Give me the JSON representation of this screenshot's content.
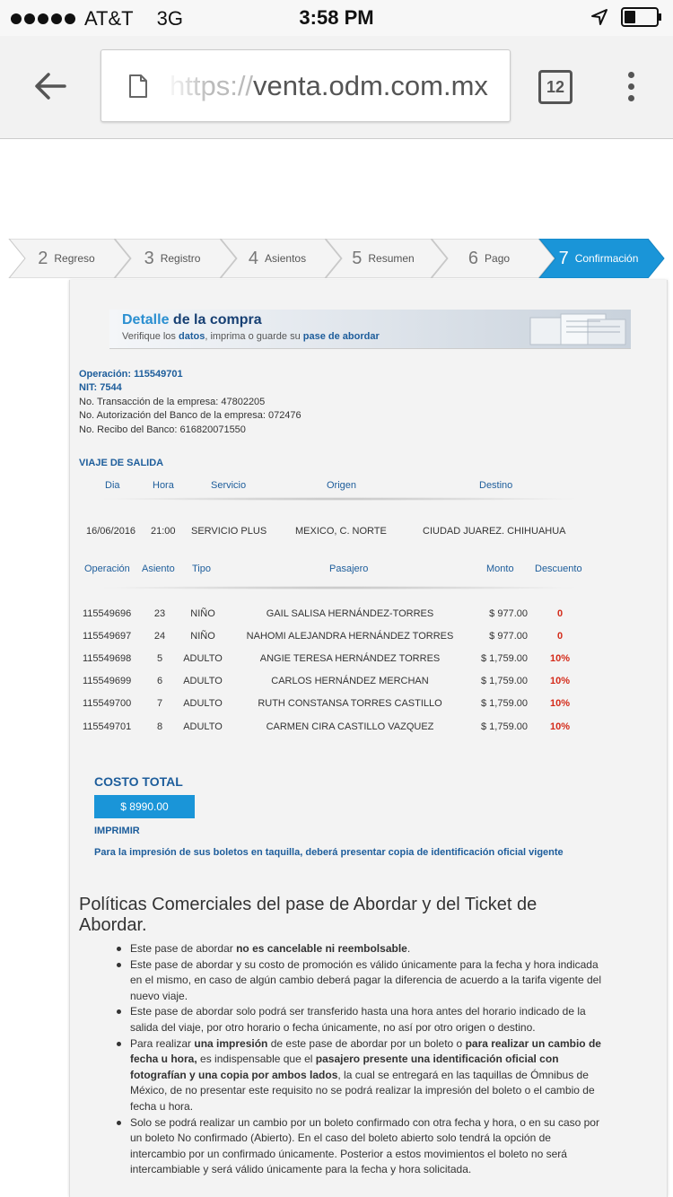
{
  "status_bar": {
    "carrier": "AT&T",
    "network": "3G",
    "time": "3:58 PM",
    "battery_level": 0.35
  },
  "browser": {
    "url_prefix": "https://",
    "url_domain": "venta.odm.com.mx",
    "tab_count": "12"
  },
  "steps": [
    {
      "num": "2",
      "label": "Regreso",
      "active": false
    },
    {
      "num": "3",
      "label": "Registro",
      "active": false
    },
    {
      "num": "4",
      "label": "Asientos",
      "active": false
    },
    {
      "num": "5",
      "label": "Resumen",
      "active": false
    },
    {
      "num": "6",
      "label": "Pago",
      "active": false
    },
    {
      "num": "7",
      "label": "Confirmación",
      "active": true
    }
  ],
  "banner": {
    "title_a": "Detalle ",
    "title_b": "de ",
    "title_c": "la compra",
    "sub_1": "Verifique los ",
    "sub_2": "datos",
    "sub_3": ", imprima o guarde su ",
    "sub_4": "pase de abordar"
  },
  "operation": {
    "operacion": "Operación: 115549701",
    "nit": "NIT: 7544",
    "transaccion": "No. Transacción de la empresa: 47802205",
    "autorizacion": "No. Autorización del Banco de la empresa: 072476",
    "recibo": "No. Recibo del Banco: 616820071550"
  },
  "trip": {
    "section_title": "VIAJE DE SALIDA",
    "headers": {
      "dia": "Dia",
      "hora": "Hora",
      "servicio": "Servicio",
      "origen": "Origen",
      "destino": "Destino"
    },
    "row": {
      "dia": "16/06/2016",
      "hora": "21:00",
      "servicio": "SERVICIO PLUS",
      "origen": "MEXICO, C. NORTE",
      "destino": "CIUDAD JUAREZ. CHIHUAHUA"
    }
  },
  "passengers": {
    "headers": {
      "operacion": "Operación",
      "asiento": "Asiento",
      "tipo": "Tipo",
      "pasajero": "Pasajero",
      "monto": "Monto",
      "descuento": "Descuento"
    },
    "rows": [
      {
        "operacion": "115549696",
        "asiento": "23",
        "tipo": "NIÑO",
        "pasajero": "GAIL SALISA HERNÁNDEZ-TORRES",
        "monto": "$ 977.00",
        "descuento": "0"
      },
      {
        "operacion": "115549697",
        "asiento": "24",
        "tipo": "NIÑO",
        "pasajero": "NAHOMI ALEJANDRA HERNÁNDEZ TORRES",
        "monto": "$ 977.00",
        "descuento": "0"
      },
      {
        "operacion": "115549698",
        "asiento": "5",
        "tipo": "ADULTO",
        "pasajero": "ANGIE TERESA HERNÁNDEZ TORRES",
        "monto": "$ 1,759.00",
        "descuento": "10%"
      },
      {
        "operacion": "115549699",
        "asiento": "6",
        "tipo": "ADULTO",
        "pasajero": "CARLOS HERNÁNDEZ MERCHAN",
        "monto": "$ 1,759.00",
        "descuento": "10%"
      },
      {
        "operacion": "115549700",
        "asiento": "7",
        "tipo": "ADULTO",
        "pasajero": "RUTH CONSTANSA TORRES CASTILLO",
        "monto": "$ 1,759.00",
        "descuento": "10%"
      },
      {
        "operacion": "115549701",
        "asiento": "8",
        "tipo": "ADULTO",
        "pasajero": "CARMEN CIRA CASTILLO VAZQUEZ",
        "monto": "$ 1,759.00",
        "descuento": "10%"
      }
    ]
  },
  "total": {
    "label": "COSTO TOTAL",
    "value": "$ 8990.00",
    "imprimir": "IMPRIMIR",
    "note": "Para la impresión de sus boletos en taquilla, deberá presentar copia de identificación oficial vigente"
  },
  "policies": {
    "title": "Políticas Comerciales del pase de Abordar y del Ticket de Abordar.",
    "b1": {
      "p1": "Este pase de abordar ",
      "s1": "no es cancelable ni reembolsable",
      "p2": "."
    },
    "b2": "Este pase de abordar y su costo de promoción es válido únicamente para la fecha y hora indicada en el mismo, en caso de algún cambio deberá pagar la diferencia de acuerdo a la tarifa vigente del nuevo viaje.",
    "b3": "Este pase de abordar solo podrá ser transferido hasta una hora antes del horario indicado de la salida del viaje, por otro horario o fecha únicamente, no así por otro origen o destino.",
    "b4": {
      "p1": "Para realizar ",
      "s1": "una impresión",
      "p2": " de este pase de abordar por un boleto o ",
      "s2": "para realizar un cambio de fecha u hora,",
      "p3": " es indispensable que el ",
      "s3": "pasajero presente una identificación oficial con fotografían y una copia por ambos lados",
      "p4": ", la cual se entregará en las taquillas de Ómnibus de México, de no presentar este requisito no se podrá realizar la impresión del boleto o el cambio de fecha u hora."
    },
    "b5": "Solo se podrá realizar un cambio por un boleto confirmado con otra fecha y hora, o en su caso por un boleto No confirmado (Abierto). En el caso del boleto abierto solo tendrá la opción de intercambio por un confirmado únicamente. Posterior a estos movimientos el boleto no será intercambiable y será válido únicamente para la fecha y hora solicitada."
  }
}
